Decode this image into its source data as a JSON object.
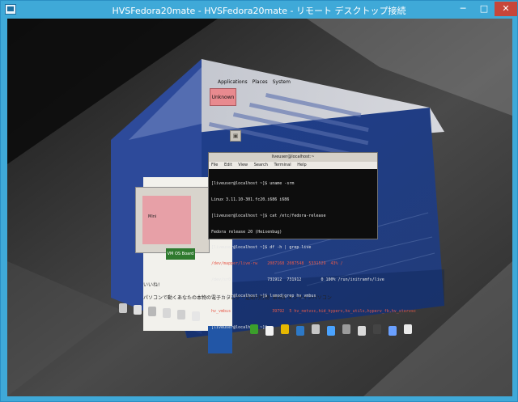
{
  "window": {
    "title": "HVSFedora20mate - HVSFedora20mate - リモート デスクトップ接続",
    "minimize_glyph": "─",
    "maximize_glyph": "□",
    "close_glyph": "✕"
  },
  "guest": {
    "panel_menu": [
      "Applications",
      "Places",
      "System"
    ],
    "unknown_label": "Unknown",
    "terminal": {
      "title": "liveuser@localhost:~",
      "menu": [
        "File",
        "Edit",
        "View",
        "Search",
        "Terminal",
        "Help"
      ],
      "lines": [
        "[liveuser@localhost ~]$ uname -srm",
        "Linux 3.11.10-301.fc20.i686 i686",
        "[liveuser@localhost ~]$ cat /etc/fedora-release",
        "Fedora release 20 (Heisenbug)",
        "[liveuser@localhost ~]$ df -h | grep live",
        "/dev/mapper/live-rw    2087168 2087548  5331529  43% /",
        "/dev/sr0               731912  731912        0 100% /run/initramfs/live",
        "[liveuser@localhost ~]$ lsmod|grep hv_vmbus",
        "hv_vmbus                 39792  5 hv_netvsc,hid_hyperv,hv_utils,hyperv_fb,hv_storvsc",
        "[liveuser@localhost ~]$ "
      ],
      "red_lines": [
        5,
        8
      ]
    },
    "left_dialog_label": "Mini",
    "vm_badge": "VM OS Board",
    "left_ok": "いいね!",
    "left_note": "パソコンで動くあなたの本物の電子カタログ・定期刊行物 第3回 オンラインパソコン"
  },
  "colors": {
    "titlebar": "#3fa9d8",
    "close_button": "#c7463a",
    "desktop_blue": "#1a3a86",
    "terminal_bg": "#0d0d0d"
  },
  "icons": [
    "app-icon",
    "minimize-icon",
    "maximize-icon",
    "close-icon",
    "trash-icon",
    "dock-icon"
  ]
}
